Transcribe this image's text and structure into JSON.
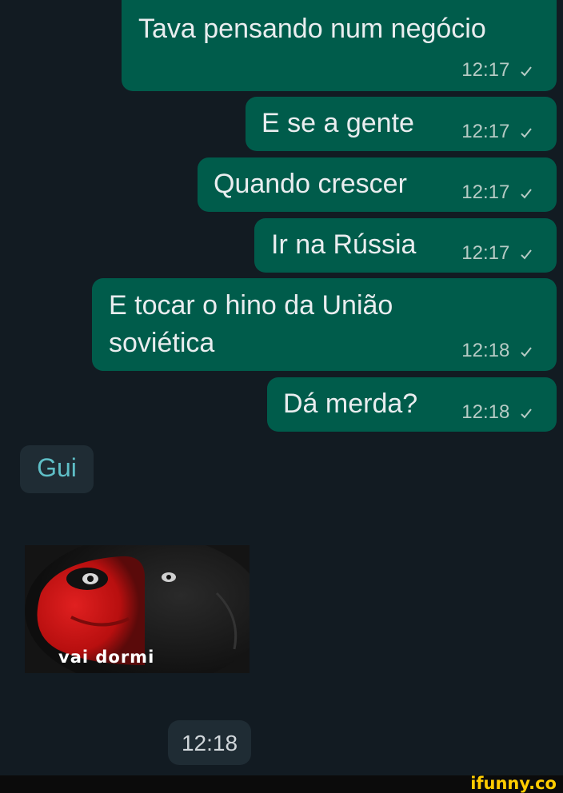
{
  "messages": [
    {
      "text": "Tava pensando num negócio",
      "time": "12:17"
    },
    {
      "text": "E se a gente",
      "time": "12:17"
    },
    {
      "text": "Quando crescer",
      "time": "12:17"
    },
    {
      "text": "Ir na Rússia",
      "time": "12:17"
    },
    {
      "line1": "E tocar o hino da União",
      "line2": "soviética",
      "time": "12:18"
    },
    {
      "text": "Dá merda?",
      "time": "12:18"
    }
  ],
  "reply": {
    "sender": "Gui",
    "sticker_caption": "vai dormi",
    "time": "12:18"
  },
  "watermark": "ifunny.co",
  "colors": {
    "background": "#121b22",
    "outgoing_bubble": "#005c4b",
    "incoming_bubble": "#1f2c34",
    "sender_name": "#5fbfc7",
    "watermark": "#ffcc00"
  }
}
